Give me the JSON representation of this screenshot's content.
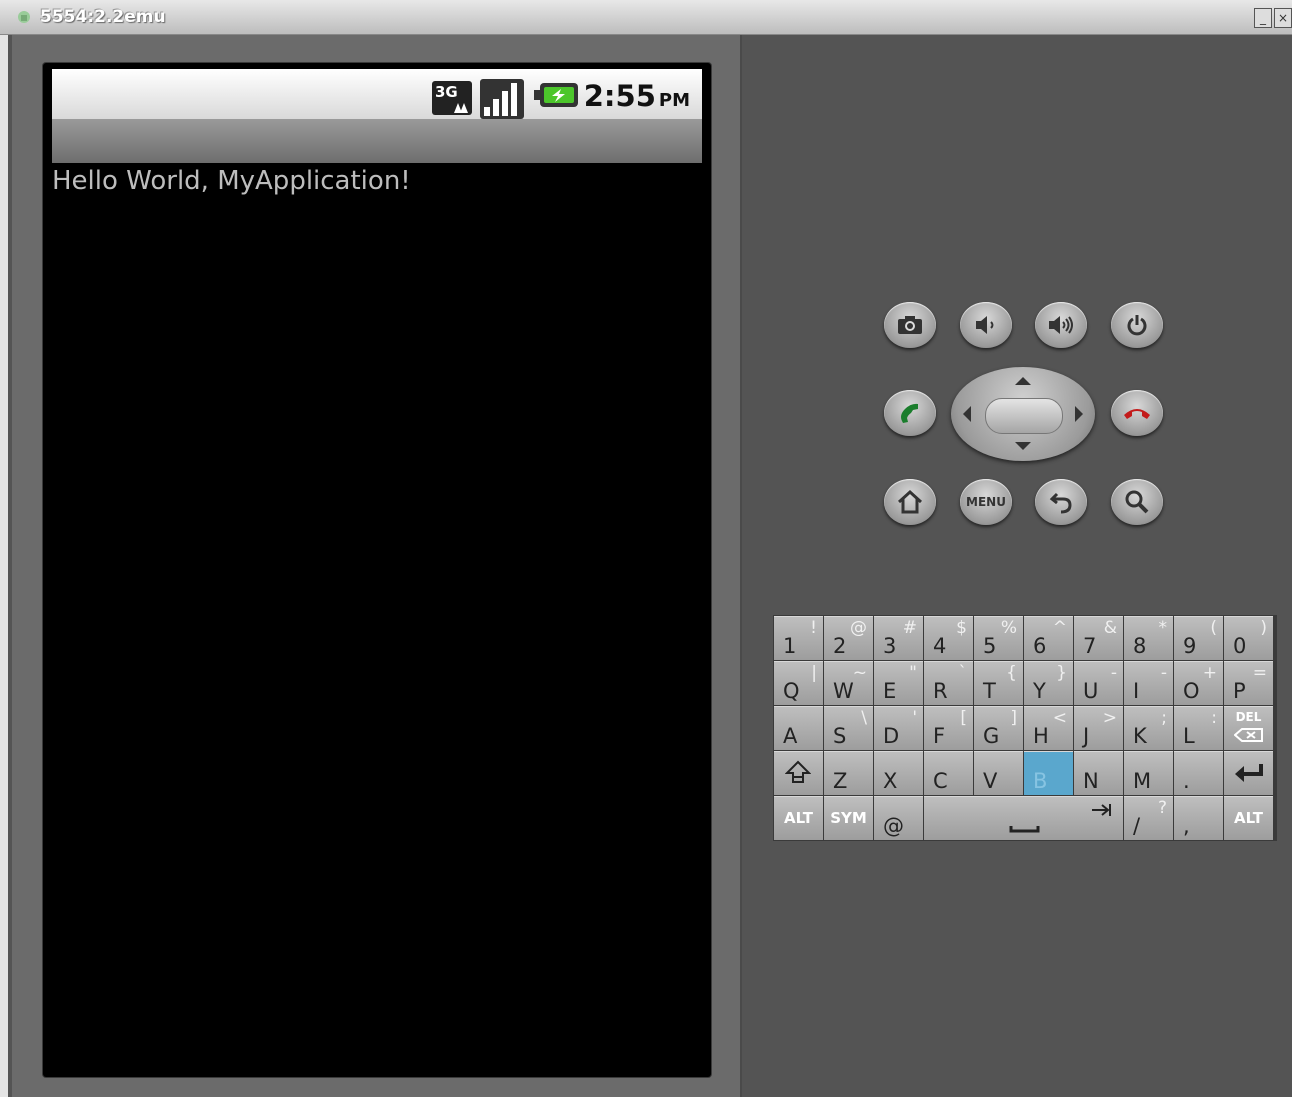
{
  "window": {
    "title": "5554:2.2emu"
  },
  "status_bar": {
    "time": "2:55",
    "ampm": "PM",
    "icons": [
      "3g-icon",
      "signal-icon",
      "battery-charging-icon"
    ]
  },
  "app": {
    "hello_text": "Hello World, MyApplication!"
  },
  "controls": {
    "row1": [
      "camera-icon",
      "volume-down-icon",
      "volume-up-icon",
      "power-icon"
    ],
    "menu_label": "MENU"
  },
  "colors": {
    "call_green": "#1a7d2c",
    "end_red": "#c31a1a",
    "highlight_key": "#5aa7cd"
  },
  "keyboard": {
    "rows": [
      [
        [
          "1",
          "!"
        ],
        [
          "2",
          "@"
        ],
        [
          "3",
          "#"
        ],
        [
          "4",
          "$"
        ],
        [
          "5",
          "%"
        ],
        [
          "6",
          "^"
        ],
        [
          "7",
          "&"
        ],
        [
          "8",
          "*"
        ],
        [
          "9",
          "("
        ],
        [
          "0",
          ")"
        ]
      ],
      [
        [
          "Q",
          "|"
        ],
        [
          "W",
          "~"
        ],
        [
          "E",
          "\""
        ],
        [
          "R",
          "`"
        ],
        [
          "T",
          "{"
        ],
        [
          "Y",
          "}"
        ],
        [
          "U",
          "-"
        ],
        [
          "I",
          "-"
        ],
        [
          "O",
          "+"
        ],
        [
          "P",
          "="
        ]
      ],
      [
        [
          "A",
          ""
        ],
        [
          "S",
          "\\"
        ],
        [
          "D",
          "'"
        ],
        [
          "F",
          "["
        ],
        [
          "G",
          "]"
        ],
        [
          "H",
          "<"
        ],
        [
          "J",
          ">"
        ],
        [
          "K",
          ";"
        ],
        [
          "L",
          ":"
        ],
        [
          "DEL",
          ""
        ]
      ],
      [
        [
          "SHIFT",
          ""
        ],
        [
          "Z",
          ""
        ],
        [
          "X",
          ""
        ],
        [
          "C",
          ""
        ],
        [
          "V",
          ""
        ],
        [
          "B",
          ""
        ],
        [
          "N",
          ""
        ],
        [
          "M",
          ""
        ],
        [
          ".",
          ""
        ],
        [
          "ENTER",
          ""
        ]
      ],
      [
        [
          "ALT",
          ""
        ],
        [
          "SYM",
          ""
        ],
        [
          "@",
          ""
        ],
        [
          "SPACE",
          ""
        ],
        [
          "/",
          "?"
        ],
        [
          ",",
          ""
        ],
        [
          "ALT",
          ""
        ]
      ]
    ],
    "highlighted_key": "B",
    "alt_label": "ALT",
    "sym_label": "SYM",
    "del_label": "DEL"
  }
}
